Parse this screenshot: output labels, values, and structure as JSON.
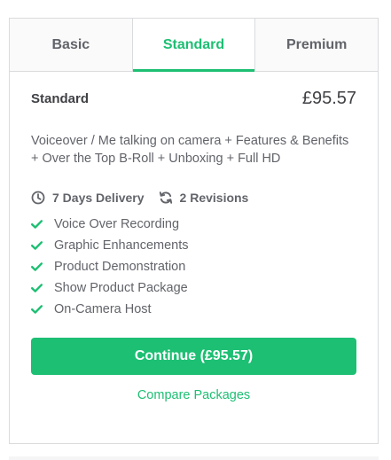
{
  "tabs": [
    {
      "label": "Basic",
      "active": false
    },
    {
      "label": "Standard",
      "active": true
    },
    {
      "label": "Premium",
      "active": false
    }
  ],
  "package": {
    "name": "Standard",
    "price": "£95.57",
    "description": "Voiceover / Me talking on camera + Features & Benefits + Over the Top B-Roll + Unboxing + Full HD",
    "delivery": "7 Days Delivery",
    "revisions": "2 Revisions",
    "delivery_icon": "clock-icon",
    "revisions_icon": "refresh-icon",
    "features": [
      "Voice Over Recording",
      "Graphic Enhancements",
      "Product Demonstration",
      "Show Product Package",
      "On-Camera Host"
    ],
    "feature_icon": "check-icon"
  },
  "actions": {
    "continue_label": "Continue (£95.57)",
    "compare_label": "Compare Packages"
  },
  "colors": {
    "accent": "#1dbf73",
    "text": "#404145",
    "muted": "#62646a",
    "border": "#dadbdd"
  }
}
